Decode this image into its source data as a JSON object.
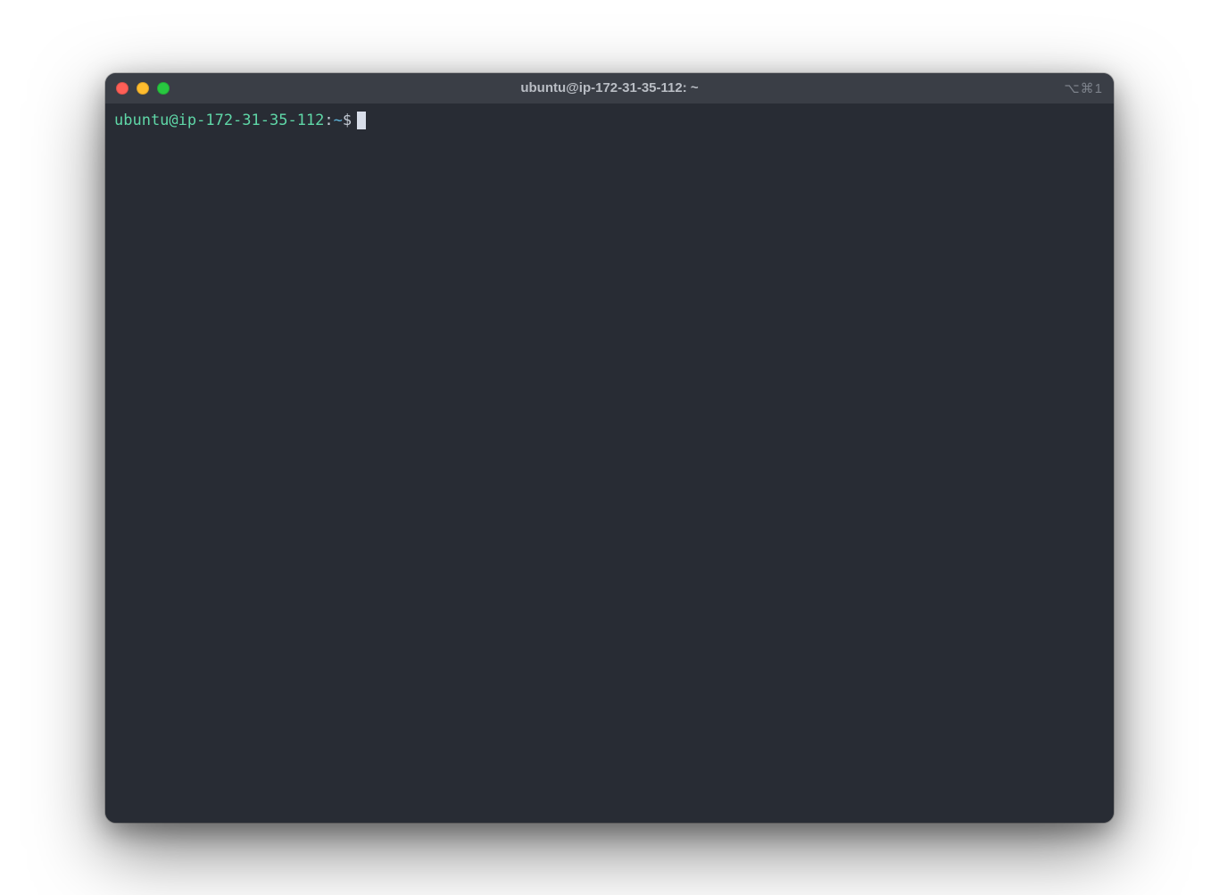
{
  "window": {
    "title": "ubuntu@ip-172-31-35-112: ~",
    "shortcut_indicator": "⌥⌘1"
  },
  "prompt": {
    "user_host": "ubuntu@ip-172-31-35-112",
    "separator1": ":",
    "cwd": "~",
    "separator2": "$",
    "command": ""
  },
  "colors": {
    "bg": "#282c34",
    "titlebar": "#3a3e46",
    "prompt_user": "#5fd7a7",
    "prompt_cwd": "#5fb3d9",
    "text": "#d8dee9",
    "traffic_red": "#ff5f57",
    "traffic_yellow": "#febc2e",
    "traffic_green": "#28c840"
  }
}
